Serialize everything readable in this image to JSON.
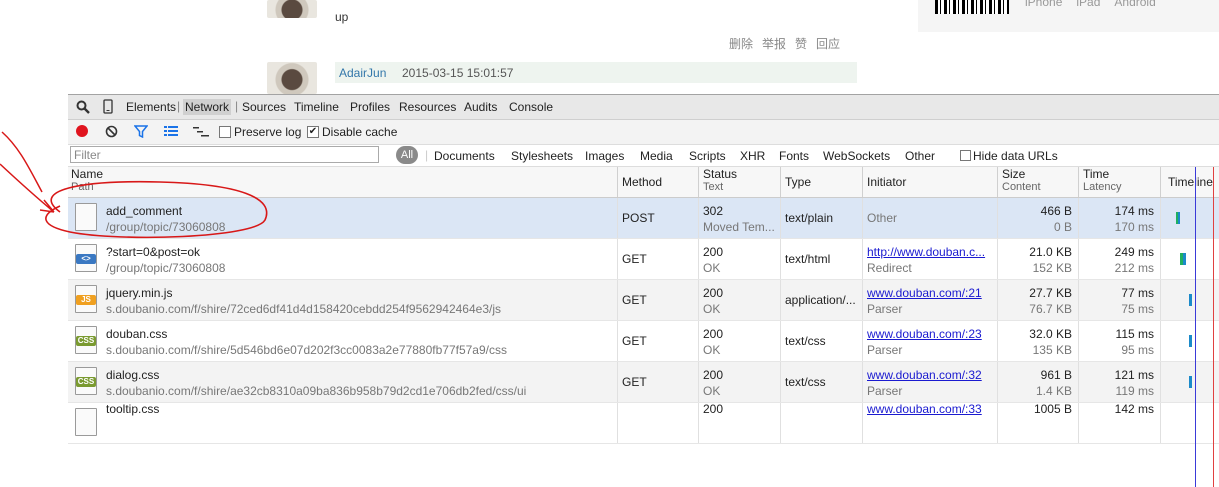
{
  "page": {
    "post_text": "up",
    "actions": [
      "删除",
      "举报",
      "赞",
      "回应"
    ],
    "comment": {
      "author": "AdairJun",
      "datetime": "2015-03-15 15:01:57"
    },
    "app_links": [
      "iPhone",
      "iPad",
      "Android"
    ]
  },
  "devtools": {
    "tabs": [
      "Elements",
      "Network",
      "Sources",
      "Timeline",
      "Profiles",
      "Resources",
      "Audits",
      "Console"
    ],
    "active_tab": "Network",
    "toolbar": {
      "preserve_log": "Preserve log",
      "disable_cache": "Disable cache",
      "preserve_checked": false,
      "disable_checked": true
    },
    "filter": {
      "placeholder": "Filter",
      "all_label": "All",
      "types": [
        "Documents",
        "Stylesheets",
        "Images",
        "Media",
        "Scripts",
        "XHR",
        "Fonts",
        "WebSockets",
        "Other"
      ],
      "hide_data_urls": "Hide data URLs"
    },
    "columns": {
      "name": "Name",
      "path": "Path",
      "method": "Method",
      "status": "Status",
      "text": "Text",
      "type": "Type",
      "initiator": "Initiator",
      "size": "Size",
      "content": "Content",
      "time": "Time",
      "latency": "Latency",
      "timeline": "Timeline"
    },
    "rows": [
      {
        "name": "add_comment",
        "path": "/group/topic/73060808",
        "method": "POST",
        "status": "302",
        "status_text": "Moved Tem...",
        "type": "text/plain",
        "initiator": "Other",
        "initiator_sub": "",
        "size": "466 B",
        "content": "0 B",
        "time": "174 ms",
        "latency": "170 ms",
        "icon": "doc-icon"
      },
      {
        "name": "?start=0&post=ok",
        "path": "/group/topic/73060808",
        "method": "GET",
        "status": "200",
        "status_text": "OK",
        "type": "text/html",
        "initiator": "http://www.douban.c...",
        "initiator_sub": "Redirect",
        "size": "21.0 KB",
        "content": "152 KB",
        "time": "249 ms",
        "latency": "212 ms",
        "icon": "html-icon"
      },
      {
        "name": "jquery.min.js",
        "path": "s.doubanio.com/f/shire/72ced6df41d4d158420cebdd254f9562942464e3/js",
        "method": "GET",
        "status": "200",
        "status_text": "OK",
        "type": "application/...",
        "initiator": "www.douban.com/:21",
        "initiator_sub": "Parser",
        "size": "27.7 KB",
        "content": "76.7 KB",
        "time": "77 ms",
        "latency": "75 ms",
        "icon": "js-icon"
      },
      {
        "name": "douban.css",
        "path": "s.doubanio.com/f/shire/5d546bd6e07d202f3cc0083a2e77880fb77f57a9/css",
        "method": "GET",
        "status": "200",
        "status_text": "OK",
        "type": "text/css",
        "initiator": "www.douban.com/:23",
        "initiator_sub": "Parser",
        "size": "32.0 KB",
        "content": "135 KB",
        "time": "115 ms",
        "latency": "95 ms",
        "icon": "css-icon"
      },
      {
        "name": "dialog.css",
        "path": "s.doubanio.com/f/shire/ae32cb8310a09ba836b958b79d2cd1e706db2fed/css/ui",
        "method": "GET",
        "status": "200",
        "status_text": "OK",
        "type": "text/css",
        "initiator": "www.douban.com/:32",
        "initiator_sub": "Parser",
        "size": "961 B",
        "content": "1.4 KB",
        "time": "121 ms",
        "latency": "119 ms",
        "icon": "css-icon"
      },
      {
        "name": "tooltip.css",
        "path": "",
        "method": "",
        "status": "200",
        "status_text": "",
        "type": "",
        "initiator": "www.douban.com/:33",
        "initiator_sub": "",
        "size": "1005 B",
        "content": "",
        "time": "142 ms",
        "latency": "",
        "icon": "css-icon"
      }
    ],
    "colors": {
      "selected_row": "#dbe6f5",
      "record": "#e0141e",
      "filter_icon": "#1a73e8",
      "link": "#1a1ad0",
      "annotation": "#d81818"
    }
  }
}
